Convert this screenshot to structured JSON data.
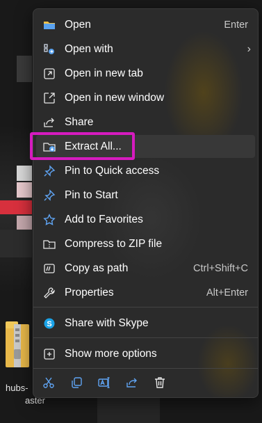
{
  "background": {
    "file_label": "hubs-",
    "file_label_2": "aster"
  },
  "menu": {
    "items": [
      {
        "label": "Open",
        "shortcut": "Enter",
        "icon": "folder-open-icon"
      },
      {
        "label": "Open with",
        "shortcut": "",
        "icon": "open-with-icon",
        "submenu": true
      },
      {
        "label": "Open in new tab",
        "shortcut": "",
        "icon": "new-tab-icon"
      },
      {
        "label": "Open in new window",
        "shortcut": "",
        "icon": "new-window-icon"
      },
      {
        "label": "Share",
        "shortcut": "",
        "icon": "share-icon"
      },
      {
        "label": "Extract All...",
        "shortcut": "",
        "icon": "extract-icon"
      },
      {
        "label": "Pin to Quick access",
        "shortcut": "",
        "icon": "pin-icon"
      },
      {
        "label": "Pin to Start",
        "shortcut": "",
        "icon": "pin-start-icon"
      },
      {
        "label": "Add to Favorites",
        "shortcut": "",
        "icon": "star-icon"
      },
      {
        "label": "Compress to ZIP file",
        "shortcut": "",
        "icon": "zip-folder-icon"
      },
      {
        "label": "Copy as path",
        "shortcut": "Ctrl+Shift+C",
        "icon": "copy-path-icon"
      },
      {
        "label": "Properties",
        "shortcut": "Alt+Enter",
        "icon": "wrench-icon"
      },
      {
        "label": "Share with Skype",
        "shortcut": "",
        "icon": "skype-icon"
      },
      {
        "label": "Show more options",
        "shortcut": "",
        "icon": "more-options-icon"
      }
    ],
    "bottom_icons": [
      "cut-icon",
      "copy-icon",
      "rename-icon",
      "share-icon",
      "delete-icon"
    ],
    "highlight_color": "#d61bbf",
    "accent_color": "#60a5f5"
  }
}
